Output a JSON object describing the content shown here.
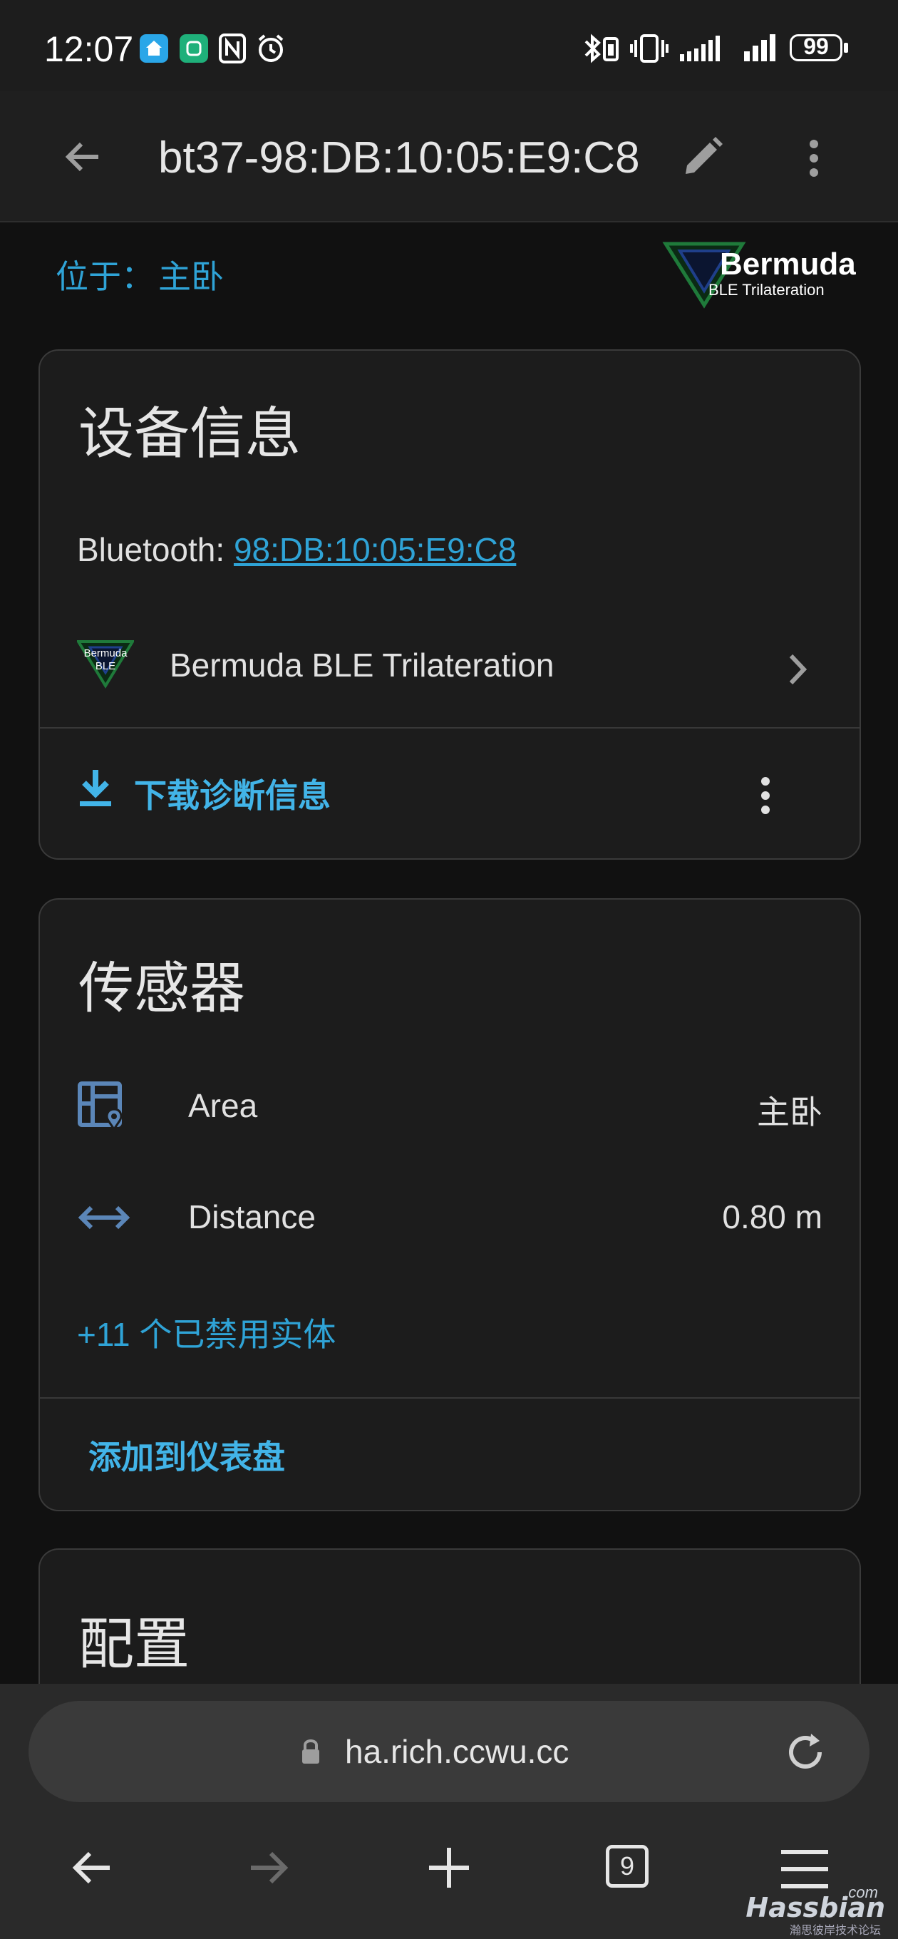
{
  "status_bar": {
    "time": "12:07",
    "battery": "99"
  },
  "header": {
    "title": "bt37-98:DB:10:05:E9:C8"
  },
  "location": {
    "label": "位于：",
    "value": "主卧"
  },
  "logo": {
    "name": "Bermuda",
    "sub": "BLE Trilateration"
  },
  "device_card": {
    "title": "设备信息",
    "bluetooth_label": "Bluetooth: ",
    "bluetooth_mac": "98:DB:10:05:E9:C8",
    "integration_name": "Bermuda BLE Trilateration",
    "integration_logo_text": "Bermuda BLE",
    "download_label": "下载诊断信息"
  },
  "sensor_card": {
    "title": "传感器",
    "rows": [
      {
        "label": "Area",
        "value": "主卧"
      },
      {
        "label": "Distance",
        "value": "0.80 m"
      }
    ],
    "disabled_entities": "+11 个已禁用实体",
    "add_dashboard": "添加到仪表盘"
  },
  "config_card": {
    "title": "配置"
  },
  "browser": {
    "url": "ha.rich.ccwu.cc",
    "tab_count": "9"
  },
  "watermark": {
    "brand": "Hassbian",
    "com": ".com",
    "sub": "瀚思彼岸技术论坛"
  },
  "colors": {
    "accent": "#2fa3d6",
    "sensor_icon": "#5b86b8",
    "background": "#111111",
    "card": "#1c1c1c"
  }
}
